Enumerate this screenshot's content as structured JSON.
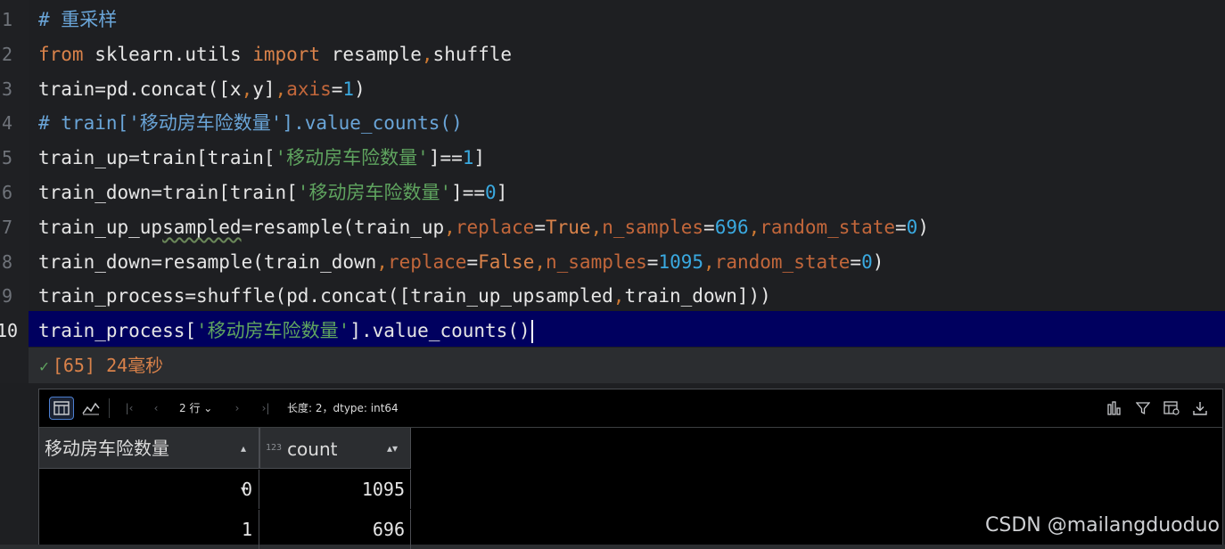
{
  "editor": {
    "line_numbers": [
      "1",
      "2",
      "3",
      "4",
      "5",
      "6",
      "7",
      "8",
      "9",
      "10"
    ],
    "lines": [
      {
        "segments": [
          {
            "t": "# 重采样",
            "c": "cm"
          }
        ]
      },
      {
        "segments": [
          {
            "t": "from",
            "c": "kw"
          },
          {
            "t": " sklearn.utils ",
            "c": ""
          },
          {
            "t": "import",
            "c": "kw"
          },
          {
            "t": " resample",
            "c": ""
          },
          {
            "t": ",",
            "c": "punc"
          },
          {
            "t": "shuffle",
            "c": ""
          }
        ]
      },
      {
        "segments": [
          {
            "t": "train=pd.concat([x",
            "c": ""
          },
          {
            "t": ",",
            "c": "punc"
          },
          {
            "t": "y]",
            "c": ""
          },
          {
            "t": ",",
            "c": "punc"
          },
          {
            "t": "axis",
            "c": "param"
          },
          {
            "t": "=",
            "c": ""
          },
          {
            "t": "1",
            "c": "num"
          },
          {
            "t": ")",
            "c": ""
          }
        ]
      },
      {
        "segments": [
          {
            "t": "# train['移动房车险数量'].value_counts()",
            "c": "cm"
          }
        ]
      },
      {
        "segments": [
          {
            "t": "train_up=train[train[",
            "c": ""
          },
          {
            "t": "'移动房车险数量'",
            "c": "str"
          },
          {
            "t": "]==",
            "c": ""
          },
          {
            "t": "1",
            "c": "num"
          },
          {
            "t": "]",
            "c": ""
          }
        ]
      },
      {
        "segments": [
          {
            "t": "train_down=train[train[",
            "c": ""
          },
          {
            "t": "'移动房车险数量'",
            "c": "str"
          },
          {
            "t": "]==",
            "c": ""
          },
          {
            "t": "0",
            "c": "num"
          },
          {
            "t": "]",
            "c": ""
          }
        ]
      },
      {
        "segments": [
          {
            "t": "train_up_up",
            "c": ""
          },
          {
            "t": "sampled",
            "c": "wavy"
          },
          {
            "t": "=resample(train_up",
            "c": ""
          },
          {
            "t": ",",
            "c": "punc"
          },
          {
            "t": "replace",
            "c": "param"
          },
          {
            "t": "=",
            "c": ""
          },
          {
            "t": "True",
            "c": "kw"
          },
          {
            "t": ",",
            "c": "punc"
          },
          {
            "t": "n_samples",
            "c": "param"
          },
          {
            "t": "=",
            "c": ""
          },
          {
            "t": "696",
            "c": "num"
          },
          {
            "t": ",",
            "c": "punc"
          },
          {
            "t": "random_state",
            "c": "param"
          },
          {
            "t": "=",
            "c": ""
          },
          {
            "t": "0",
            "c": "num"
          },
          {
            "t": ")",
            "c": ""
          }
        ]
      },
      {
        "segments": [
          {
            "t": "train_down=resample(train_down",
            "c": ""
          },
          {
            "t": ",",
            "c": "punc"
          },
          {
            "t": "replace",
            "c": "param"
          },
          {
            "t": "=",
            "c": ""
          },
          {
            "t": "False",
            "c": "kw"
          },
          {
            "t": ",",
            "c": "punc"
          },
          {
            "t": "n_samples",
            "c": "param"
          },
          {
            "t": "=",
            "c": ""
          },
          {
            "t": "1095",
            "c": "num"
          },
          {
            "t": ",",
            "c": "punc"
          },
          {
            "t": "random_state",
            "c": "param"
          },
          {
            "t": "=",
            "c": ""
          },
          {
            "t": "0",
            "c": "num"
          },
          {
            "t": ")",
            "c": ""
          }
        ]
      },
      {
        "segments": [
          {
            "t": "train_process=shuffle(pd.concat([train_up_upsampled",
            "c": ""
          },
          {
            "t": ",",
            "c": "punc"
          },
          {
            "t": "train_down]))",
            "c": ""
          }
        ]
      },
      {
        "segments": [
          {
            "t": "train_process[",
            "c": ""
          },
          {
            "t": "'移动房车险数量'",
            "c": "str"
          },
          {
            "t": "].value_counts()",
            "c": ""
          }
        ]
      }
    ]
  },
  "status": {
    "exec_count": "[65]",
    "duration": "24毫秒"
  },
  "toolbar": {
    "rows_label": "2 行",
    "info": "长度: 2，dtype: int64"
  },
  "table": {
    "headers": [
      "移动房车险数量",
      "count"
    ],
    "type_icon": "123",
    "rows": [
      [
        "0",
        "1095"
      ],
      [
        "1",
        "696"
      ]
    ]
  },
  "watermark": "CSDN @mailangduoduo"
}
